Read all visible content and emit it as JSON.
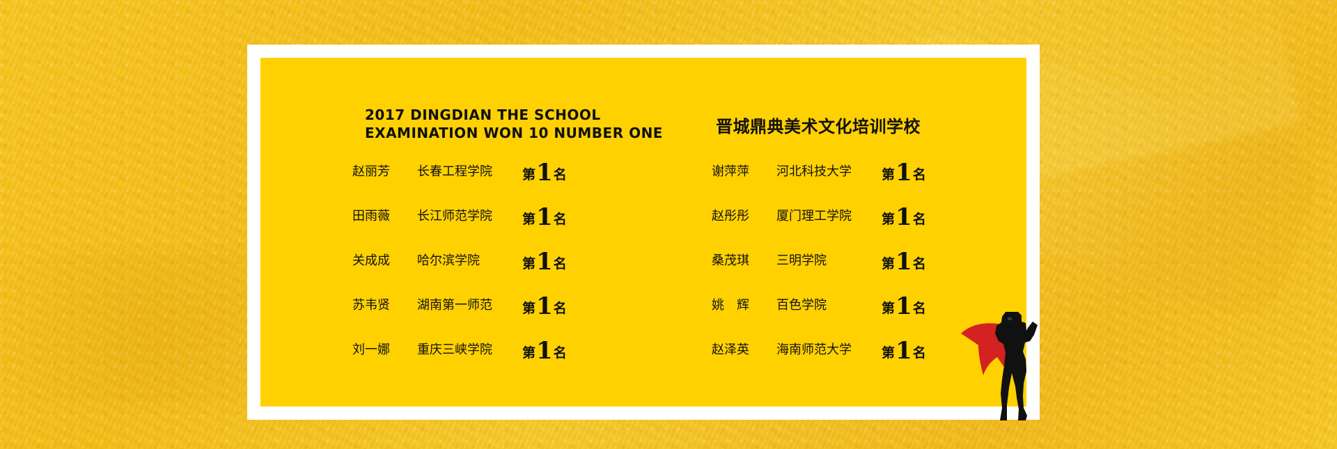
{
  "header": {
    "english_title": "2017 DINGDIAN THE SCHOOL\nEXAMINATION WON 10 NUMBER ONE",
    "chinese_title": "晋城鼎典美术文化培训学校"
  },
  "results": {
    "left": [
      {
        "name": "赵丽芳",
        "school": "长春工程学院",
        "rank_prefix": "第",
        "rank_number": "1",
        "rank_suffix": "名"
      },
      {
        "name": "田雨薇",
        "school": "长江师范学院",
        "rank_prefix": "第",
        "rank_number": "1",
        "rank_suffix": "名"
      },
      {
        "name": "关成成",
        "school": "哈尔滨学院",
        "rank_prefix": "第",
        "rank_number": "1",
        "rank_suffix": "名"
      },
      {
        "name": "苏韦贤",
        "school": "湖南第一师范",
        "rank_prefix": "第",
        "rank_number": "1",
        "rank_suffix": "名"
      },
      {
        "name": "刘一娜",
        "school": "重庆三峡学院",
        "rank_prefix": "第",
        "rank_number": "1",
        "rank_suffix": "名"
      }
    ],
    "right": [
      {
        "name": "谢萍萍",
        "school": "河北科技大学",
        "rank_prefix": "第",
        "rank_number": "1",
        "rank_suffix": "名"
      },
      {
        "name": "赵彤彤",
        "school": "厦门理工学院",
        "rank_prefix": "第",
        "rank_number": "1",
        "rank_suffix": "名"
      },
      {
        "name": "桑茂琪",
        "school": "三明学院",
        "rank_prefix": "第",
        "rank_number": "1",
        "rank_suffix": "名"
      },
      {
        "name": "姚　辉",
        "school": "百色学院",
        "rank_prefix": "第",
        "rank_number": "1",
        "rank_suffix": "名"
      },
      {
        "name": "赵泽英",
        "school": "海南师范大学",
        "rank_prefix": "第",
        "rank_number": "1",
        "rank_suffix": "名"
      }
    ]
  },
  "illustration": {
    "icon": "superhero-icon",
    "cape_color": "#d42121",
    "body_color": "#111111"
  },
  "colors": {
    "panel": "#ffd100",
    "frame": "#ffffff",
    "text": "#111111"
  }
}
